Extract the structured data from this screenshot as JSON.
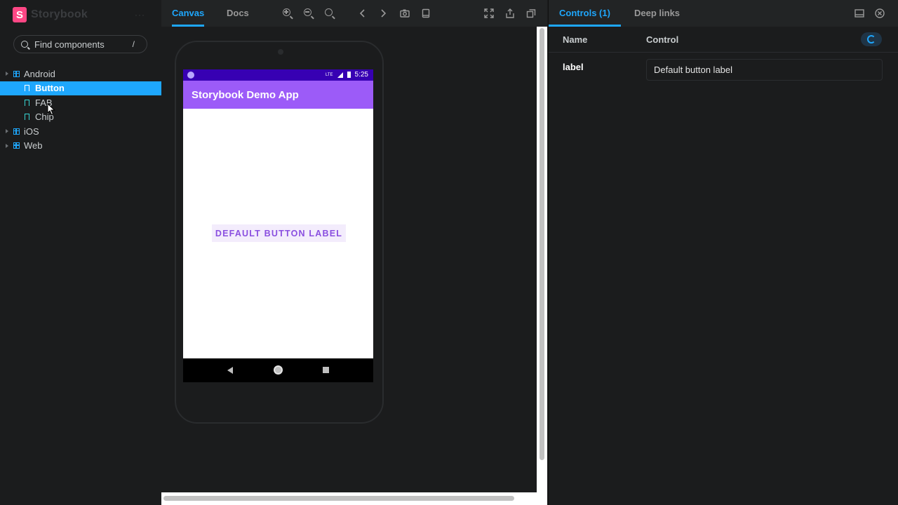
{
  "sidebar": {
    "brand": "Storybook",
    "search_placeholder": "Find components",
    "search_shortcut": "/",
    "tree": [
      {
        "label": "Android",
        "level": 1,
        "type": "group"
      },
      {
        "label": "Button",
        "level": 2,
        "type": "story",
        "selected": true
      },
      {
        "label": "FAB",
        "level": 2,
        "type": "story"
      },
      {
        "label": "Chip",
        "level": 2,
        "type": "story"
      },
      {
        "label": "iOS",
        "level": 1,
        "type": "group"
      },
      {
        "label": "Web",
        "level": 1,
        "type": "group"
      }
    ]
  },
  "toolbar": {
    "tabs": [
      "Canvas",
      "Docs"
    ],
    "icons": [
      "zoom-in-icon",
      "zoom-out-icon",
      "zoom-reset-icon",
      "chevron-left-icon",
      "chevron-right-icon",
      "camera-icon",
      "tablet-icon",
      "fullscreen-icon",
      "share-icon",
      "copy-icon"
    ]
  },
  "device": {
    "status_network": "LTE",
    "status_time": "5:25",
    "app_title": "Storybook Demo App",
    "button_label": "DEFAULT BUTTON LABEL"
  },
  "panel": {
    "tabs": [
      "Controls (1)",
      "Deep links"
    ],
    "columns": [
      "Name",
      "Control"
    ],
    "controls": [
      {
        "name": "label",
        "value": "Default button label"
      }
    ]
  },
  "colors": {
    "accent": "#1ea7fd",
    "brand": "#ff4785",
    "app_bar": "#9c5bf8",
    "status_bar": "#3700b3",
    "button_text": "#8a4fe0"
  }
}
